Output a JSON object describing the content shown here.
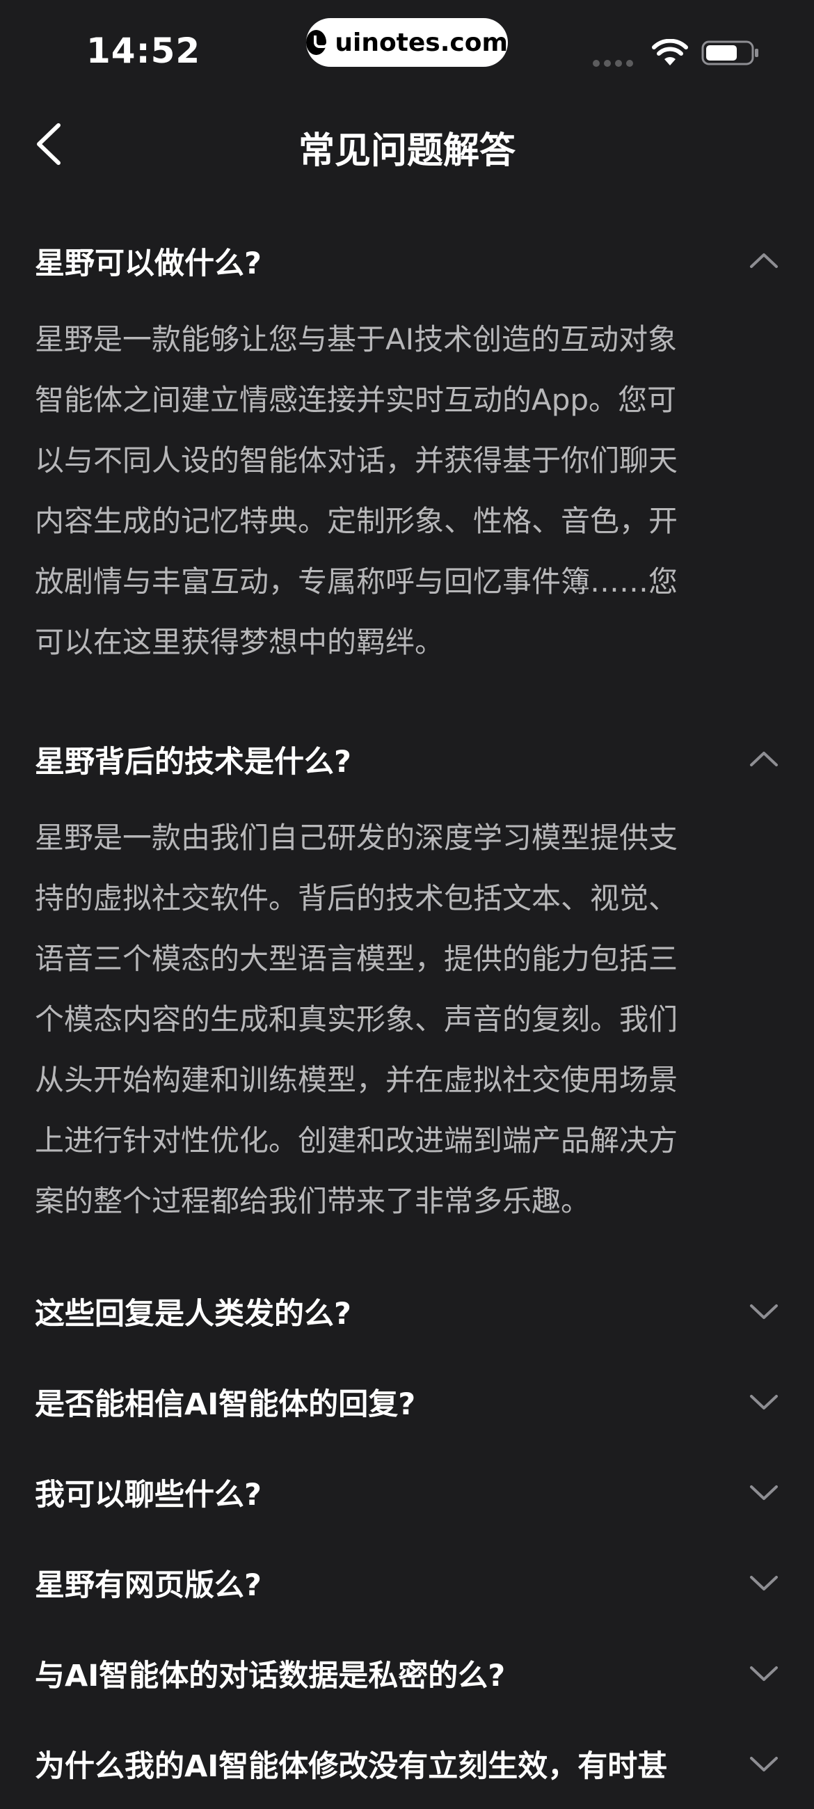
{
  "status_bar": {
    "time": "14:52",
    "watermark": "uinotes.com"
  },
  "header": {
    "title": "常见问题解答"
  },
  "faq": [
    {
      "question": "星野可以做什么?",
      "expanded": true,
      "answer": "星野是一款能够让您与基于AI技术创造的互动对象\n智能体之间建立情感连接并实时互动的App。您可\n以与不同人设的智能体对话，并获得基于你们聊天\n内容生成的记忆特典。定制形象、性格、音色，开\n放剧情与丰富互动，专属称呼与回忆事件簿……您\n可以在这里获得梦想中的羁绊。"
    },
    {
      "question": "星野背后的技术是什么?",
      "expanded": true,
      "answer": "星野是一款由我们自己研发的深度学习模型提供支\n持的虚拟社交软件。背后的技术包括文本、视觉、\n语音三个模态的大型语言模型，提供的能力包括三\n个模态内容的生成和真实形象、声音的复刻。我们\n从头开始构建和训练模型，并在虚拟社交使用场景\n上进行针对性优化。创建和改进端到端产品解决方\n案的整个过程都给我们带来了非常多乐趣。"
    },
    {
      "question": "这些回复是人类发的么?",
      "expanded": false
    },
    {
      "question": "是否能相信AI智能体的回复?",
      "expanded": false
    },
    {
      "question": "我可以聊些什么?",
      "expanded": false
    },
    {
      "question": "星野有网页版么?",
      "expanded": false
    },
    {
      "question": "与AI智能体的对话数据是私密的么?",
      "expanded": false
    },
    {
      "question": "为什么我的AI智能体修改没有立刻生效，有时甚",
      "expanded": false
    }
  ],
  "icons": {
    "back": "chevron-left-icon",
    "expanded": "chevron-up-icon",
    "collapsed": "chevron-down-icon"
  },
  "colors": {
    "background": "#1c1c1e",
    "question_text": "#ffffff",
    "answer_text": "#b7b7b9",
    "chevron": "#8e8e93"
  }
}
